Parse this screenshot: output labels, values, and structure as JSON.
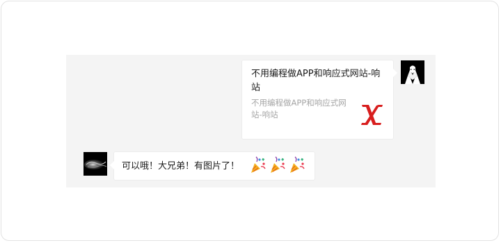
{
  "messages": [
    {
      "side": "right",
      "avatar_icon": "tuxedo-man-avatar-icon",
      "card": {
        "title": "不用编程做APP和响应式网站-响站",
        "description": "不用编程做APP和响应式网站-响站",
        "thumbnail_icon": "red-x-logo-icon",
        "thumbnail_color": "#d81e1e"
      }
    },
    {
      "side": "left",
      "avatar_icon": "dark-smoke-avatar-icon",
      "text": "可以哦！大兄弟！有图片了！",
      "emoji_icons": [
        "party-popper-icon",
        "party-popper-icon",
        "party-popper-icon"
      ]
    }
  ]
}
